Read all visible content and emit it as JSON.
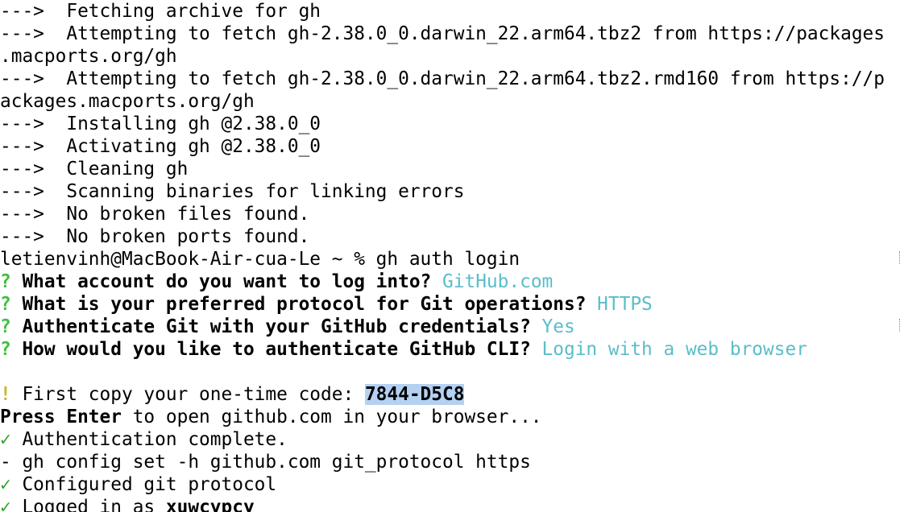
{
  "terminal": {
    "lines": [
      {
        "prefix": "--->",
        "text": "  Fetching archive for gh"
      },
      {
        "prefix": "--->",
        "text": "  Attempting to fetch gh-2.38.0_0.darwin_22.arm64.tbz2 from https://packages"
      },
      {
        "prefix": "",
        "text": ".macports.org/gh"
      },
      {
        "prefix": "--->",
        "text": "  Attempting to fetch gh-2.38.0_0.darwin_22.arm64.tbz2.rmd160 from https://p"
      },
      {
        "prefix": "",
        "text": "ackages.macports.org/gh"
      },
      {
        "prefix": "--->",
        "text": "  Installing gh @2.38.0_0"
      },
      {
        "prefix": "--->",
        "text": "  Activating gh @2.38.0_0"
      },
      {
        "prefix": "--->",
        "text": "  Cleaning gh"
      },
      {
        "prefix": "--->",
        "text": "  Scanning binaries for linking errors"
      },
      {
        "prefix": "--->",
        "text": "  No broken files found."
      },
      {
        "prefix": "--->",
        "text": "  No broken ports found."
      }
    ],
    "prompt": "letienvinh@MacBook-Air-cua-Le ~ % gh auth login",
    "qa": [
      {
        "mark": "?",
        "question": " What account do you want to log into? ",
        "answer": "GitHub.com"
      },
      {
        "mark": "?",
        "question": " What is your preferred protocol for Git operations? ",
        "answer": "HTTPS"
      },
      {
        "mark": "?",
        "question": " Authenticate Git with your GitHub credentials? ",
        "answer": "Yes"
      },
      {
        "mark": "?",
        "question": " How would you like to authenticate GitHub CLI? ",
        "answer": "Login with a web browser"
      }
    ],
    "otp": {
      "mark": "!",
      "label": " First copy your one-time code: ",
      "code": "7844-D5C8"
    },
    "press_enter": {
      "bold": "Press Enter",
      "rest": " to open github.com in your browser..."
    },
    "results": [
      {
        "mark": "✓",
        "text": " Authentication complete."
      },
      {
        "mark": "-",
        "text": " gh config set -h github.com git_protocol https"
      },
      {
        "mark": "✓",
        "text": " Configured git protocol"
      }
    ],
    "logged_in": {
      "mark": "✓",
      "text": " Logged in as ",
      "user": "xuwcypcy"
    }
  },
  "colors": {
    "green": "#3fbf3f",
    "cyan": "#5bbdc9",
    "yellow": "#c9b83a",
    "highlight": "#b4d1f2"
  }
}
